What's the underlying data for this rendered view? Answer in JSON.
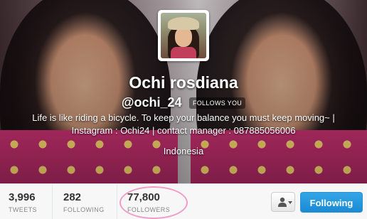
{
  "profile": {
    "name": "Ochi rosdiana",
    "handle": "@ochi_24",
    "follows_you_badge": "FOLLOWS YOU",
    "bio": "Life is like riding a bicycle. To keep your balance you must keep moving~ | Instagram : Ochi24 | contact manager : 087885056006",
    "location": "Indonesia"
  },
  "stats": {
    "tweets": {
      "value": "3,996",
      "label": "TWEETS"
    },
    "following": {
      "value": "282",
      "label": "FOLLOWING"
    },
    "followers": {
      "value": "77,800",
      "label": "FOLLOWERS"
    }
  },
  "actions": {
    "user_menu_icon": "person-icon",
    "follow_button_label": "Following"
  },
  "colors": {
    "follow_button": "#1a8ad4",
    "highlight_ring": "#f19cc8",
    "stats_bg": "#f7f7f7"
  }
}
